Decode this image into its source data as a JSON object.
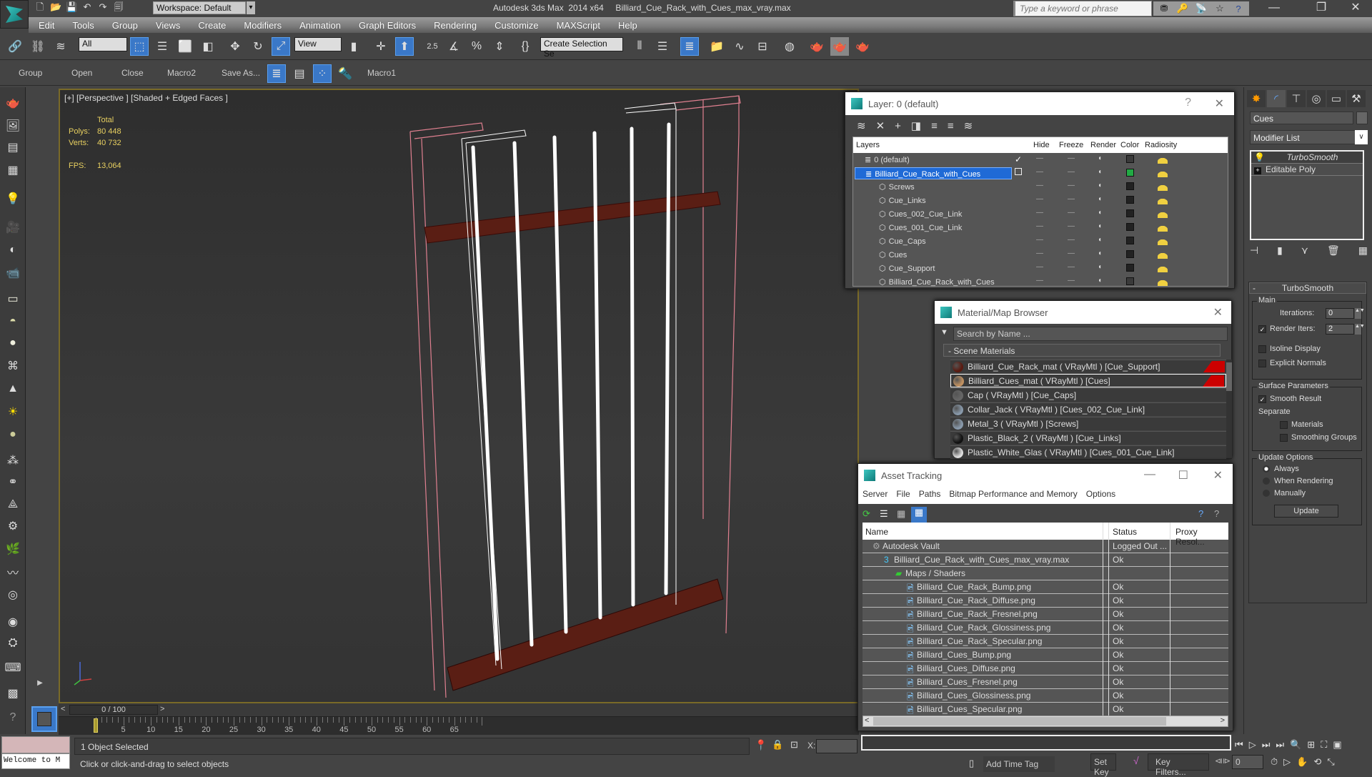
{
  "app": {
    "title": "Autodesk 3ds Max  2014 x64     Billiard_Cue_Rack_with_Cues_max_vray.max",
    "workspace": "Workspace: Default",
    "search_placeholder": "Type a keyword or phrase"
  },
  "menu": [
    "Edit",
    "Tools",
    "Group",
    "Views",
    "Create",
    "Modifiers",
    "Animation",
    "Graph Editors",
    "Rendering",
    "Customize",
    "MAXScript",
    "Help"
  ],
  "toolbar": {
    "selection_filter": "All",
    "reference_coord": "View",
    "snap_value": "2.5",
    "named_selection_placeholder": "Create Selection Se"
  },
  "toolbar2": {
    "buttons": [
      "Group",
      "Open",
      "Close",
      "Macro2",
      "Save As...",
      "Macro1"
    ]
  },
  "viewport": {
    "label": "[+] [Perspective ] [Shaded + Edged Faces ]",
    "stats_header": "Total",
    "polys_label": "Polys:",
    "polys": "80 448",
    "verts_label": "Verts:",
    "verts": "40 732",
    "fps_label": "FPS:",
    "fps": "13,064"
  },
  "timeline": {
    "frame_display": "0 / 100",
    "current_frame": 0,
    "total_frames": 100,
    "ticks": [
      "0",
      "5",
      "10",
      "15",
      "20",
      "25",
      "30",
      "35",
      "40",
      "45",
      "50",
      "55",
      "60",
      "65"
    ]
  },
  "status": {
    "welcome": "Welcome to M",
    "selection": "1 Object Selected",
    "prompt": "Click or click-and-drag to select objects",
    "x_label": "X:",
    "add_time_tag": "Add Time Tag",
    "set_key": "Set Key",
    "key_filters": "Key Filters...",
    "frame_field": "0"
  },
  "layer_dialog": {
    "title": "Layer: 0 (default)",
    "help": "?",
    "columns": [
      "Layers",
      "Hide",
      "Freeze",
      "Render",
      "Color",
      "Radiosity"
    ],
    "rows": [
      {
        "name": "0 (default)",
        "level": 0,
        "type": "layer",
        "active": true,
        "color": "#3a3a3a"
      },
      {
        "name": "Billiard_Cue_Rack_with_Cues",
        "level": 0,
        "type": "layer",
        "selected": true,
        "color": "#22aa44"
      },
      {
        "name": "Screws",
        "level": 1,
        "type": "object",
        "color": "#222222"
      },
      {
        "name": "Cue_Links",
        "level": 1,
        "type": "object",
        "color": "#222222"
      },
      {
        "name": "Cues_002_Cue_Link",
        "level": 1,
        "type": "object",
        "color": "#222222"
      },
      {
        "name": "Cues_001_Cue_Link",
        "level": 1,
        "type": "object",
        "color": "#222222"
      },
      {
        "name": "Cue_Caps",
        "level": 1,
        "type": "object",
        "color": "#222222"
      },
      {
        "name": "Cues",
        "level": 1,
        "type": "object",
        "color": "#222222"
      },
      {
        "name": "Cue_Support",
        "level": 1,
        "type": "object",
        "color": "#222222"
      },
      {
        "name": "Billiard_Cue_Rack_with_Cues",
        "level": 1,
        "type": "object",
        "color": "#3a3a3a"
      }
    ]
  },
  "material_browser": {
    "title": "Material/Map Browser",
    "search_placeholder": "Search by Name ...",
    "group": "- Scene Materials",
    "items": [
      {
        "label": "Billiard_Cue_Rack_mat  ( VRayMtl ) [Cue_Support]",
        "ball": "#5a1a10",
        "hot": true
      },
      {
        "label": "Billiard_Cues_mat  ( VRayMtl ) [Cues]",
        "ball": "#c09060",
        "hot": true,
        "selected": true
      },
      {
        "label": "Cap  ( VRayMtl ) [Cue_Caps]",
        "ball": "#666666"
      },
      {
        "label": "Collar_Jack  ( VRayMtl ) [Cues_002_Cue_Link]",
        "ball": "#8899aa"
      },
      {
        "label": "Metal_3  ( VRayMtl ) [Screws]",
        "ball": "#8899aa"
      },
      {
        "label": "Plastic_Black_2  ( VRayMtl ) [Cue_Links]",
        "ball": "#111111"
      },
      {
        "label": "Plastic_White_Glas  ( VRayMtl ) [Cues_001_Cue_Link]",
        "ball": "#dddddd"
      }
    ]
  },
  "asset_tracking": {
    "title": "Asset Tracking",
    "menu": [
      "Server",
      "File",
      "Paths",
      "Bitmap Performance and Memory",
      "Options"
    ],
    "columns": [
      "Name",
      "Status",
      "Proxy Resol..."
    ],
    "rows": [
      {
        "name": "Autodesk Vault",
        "status": "Logged Out ...",
        "level": 1,
        "icon": "vault"
      },
      {
        "name": "Billiard_Cue_Rack_with_Cues_max_vray.max",
        "status": "Ok",
        "level": 2,
        "icon": "max"
      },
      {
        "name": "Maps / Shaders",
        "status": "",
        "level": 3,
        "icon": "maps"
      },
      {
        "name": "Billiard_Cue_Rack_Bump.png",
        "status": "Ok",
        "level": 4,
        "icon": "file"
      },
      {
        "name": "Billiard_Cue_Rack_Diffuse.png",
        "status": "Ok",
        "level": 4,
        "icon": "file"
      },
      {
        "name": "Billiard_Cue_Rack_Fresnel.png",
        "status": "Ok",
        "level": 4,
        "icon": "file"
      },
      {
        "name": "Billiard_Cue_Rack_Glossiness.png",
        "status": "Ok",
        "level": 4,
        "icon": "file"
      },
      {
        "name": "Billiard_Cue_Rack_Specular.png",
        "status": "Ok",
        "level": 4,
        "icon": "file"
      },
      {
        "name": "Billiard_Cues_Bump.png",
        "status": "Ok",
        "level": 4,
        "icon": "file"
      },
      {
        "name": "Billiard_Cues_Diffuse.png",
        "status": "Ok",
        "level": 4,
        "icon": "file"
      },
      {
        "name": "Billiard_Cues_Fresnel.png",
        "status": "Ok",
        "level": 4,
        "icon": "file"
      },
      {
        "name": "Billiard_Cues_Glossiness.png",
        "status": "Ok",
        "level": 4,
        "icon": "file"
      },
      {
        "name": "Billiard_Cues_Specular.png",
        "status": "Ok",
        "level": 4,
        "icon": "file"
      }
    ]
  },
  "command_panel": {
    "object_name": "Cues",
    "modifier_list": "Modifier List",
    "stack": [
      "TurboSmooth",
      "Editable Poly"
    ],
    "rollout_title": "TurboSmooth",
    "main_group": "Main",
    "iterations_label": "Iterations:",
    "iterations": "0",
    "render_iters_label": "Render Iters:",
    "render_iters": "2",
    "render_iters_checked": true,
    "isoline_label": "Isoline Display",
    "isoline_checked": false,
    "explicit_normals_label": "Explicit Normals",
    "explicit_normals_checked": false,
    "surface_group": "Surface Parameters",
    "smooth_result_label": "Smooth Result",
    "smooth_result_checked": true,
    "separate_label": "Separate",
    "materials_label": "Materials",
    "smoothing_groups_label": "Smoothing Groups",
    "update_group": "Update Options",
    "update_options": [
      "Always",
      "When Rendering",
      "Manually"
    ],
    "update_selected": "Always",
    "update_button": "Update"
  }
}
